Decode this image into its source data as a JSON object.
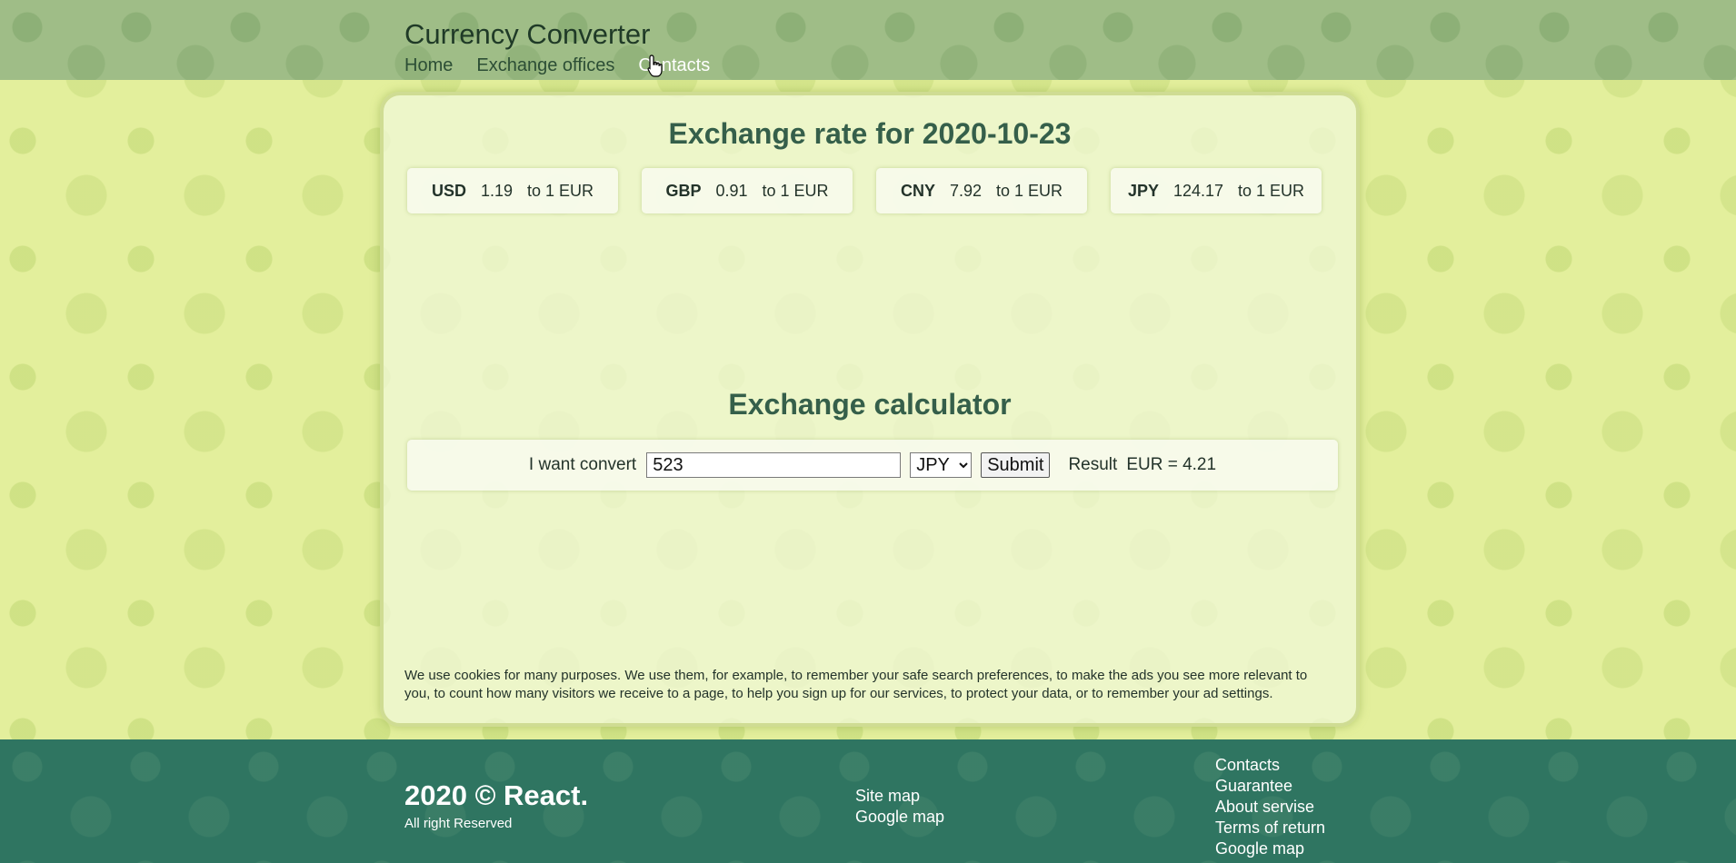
{
  "header": {
    "title": "Currency Converter",
    "nav": [
      "Home",
      "Exchange offices",
      "Contacts"
    ],
    "active_nav": "Contacts"
  },
  "rates": {
    "title": "Exchange rate for 2020-10-23",
    "items": [
      {
        "code": "USD",
        "value": "1.19",
        "suffix": "to 1 EUR"
      },
      {
        "code": "GBP",
        "value": "0.91",
        "suffix": "to 1 EUR"
      },
      {
        "code": "CNY",
        "value": "7.92",
        "suffix": "to 1 EUR"
      },
      {
        "code": "JPY",
        "value": "124.17",
        "suffix": "to 1 EUR"
      }
    ]
  },
  "calculator": {
    "title": "Exchange calculator",
    "label": "I want convert",
    "amount": "523",
    "currency": "JPY",
    "submit_label": "Submit",
    "result_label": "Result",
    "result_value": "EUR = 4.21"
  },
  "cookie_notice": "We use cookies for many purposes. We use them, for example, to remember your safe search preferences, to make the ads you see more relevant to you, to count how many visitors we receive to a page, to help you sign up for our services, to protect your data, or to remember your ad settings.",
  "footer": {
    "copyright": "2020 © React.",
    "rights": "All right Reserved",
    "links_mid": [
      "Site map",
      "Google map"
    ],
    "links_right": [
      "Contacts",
      "Guarantee",
      "About servise",
      "Terms of return",
      "Google map"
    ]
  },
  "colors": {
    "header_bg": "#9fbd87",
    "page_bg": "#e3ef9c",
    "footer_bg": "#2f7561",
    "heading": "#355f4a"
  },
  "icons": [
    "pointer-hand-cursor-icon"
  ]
}
